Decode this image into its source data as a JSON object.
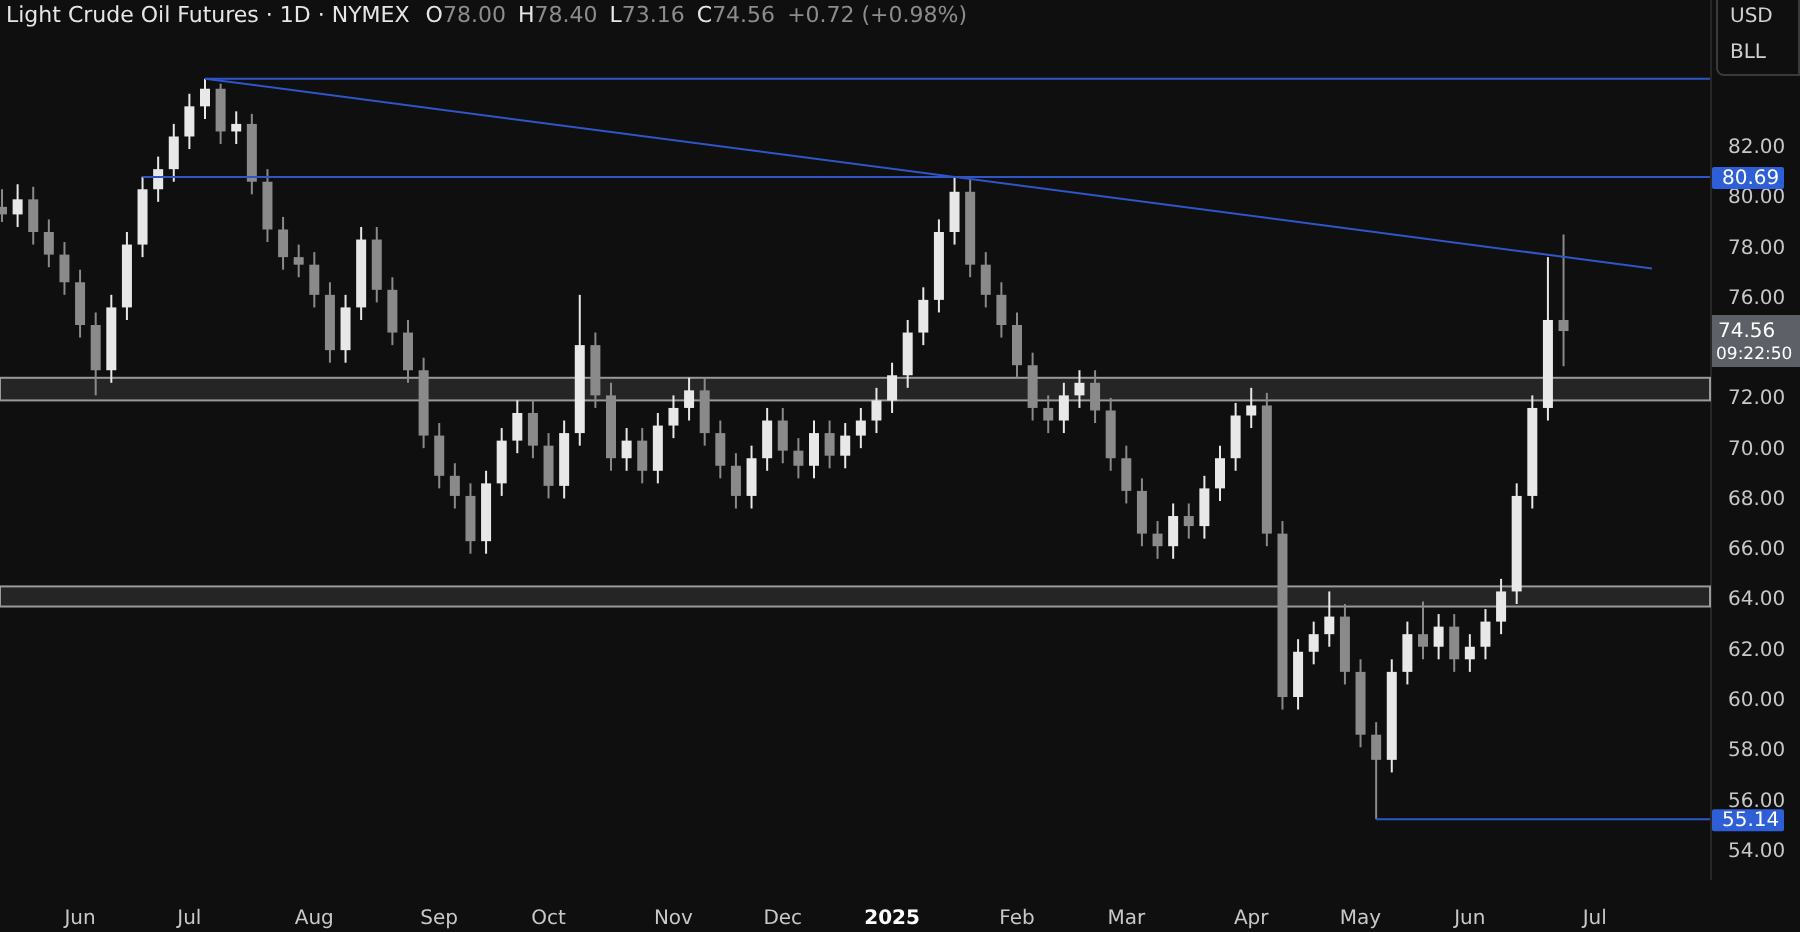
{
  "header": {
    "title": "Light Crude Oil Futures · 1D · NYMEX",
    "ohlc": [
      {
        "key": "O",
        "value": "78.00"
      },
      {
        "key": "H",
        "value": "78.40"
      },
      {
        "key": "L",
        "value": "73.16"
      },
      {
        "key": "C",
        "value": "74.56"
      }
    ],
    "change": "+0.72 (+0.98%)"
  },
  "currency_box": {
    "currency": "USD",
    "unit": "BLL"
  },
  "chart": {
    "chart_data": {
      "type": "candlestick",
      "categories": [
        null,
        null,
        null,
        null,
        null,
        "Jun",
        null,
        null,
        null,
        null,
        null,
        null,
        "Jul",
        null,
        null,
        null,
        null,
        null,
        null,
        null,
        "Aug",
        null,
        null,
        null,
        null,
        null,
        null,
        null,
        "Sep",
        null,
        null,
        null,
        null,
        null,
        null,
        "Oct",
        null,
        null,
        null,
        null,
        null,
        null,
        null,
        "Nov",
        null,
        null,
        null,
        null,
        null,
        null,
        "Dec",
        null,
        null,
        null,
        null,
        null,
        null,
        "2025",
        null,
        null,
        null,
        null,
        null,
        null,
        null,
        "Feb",
        null,
        null,
        null,
        null,
        null,
        null,
        "Mar",
        null,
        null,
        null,
        null,
        null,
        null,
        null,
        "Apr",
        null,
        null,
        null,
        null,
        null,
        null,
        "May",
        null,
        null,
        null,
        null,
        null,
        null,
        "Jun",
        null,
        null,
        null,
        null,
        null,
        null,
        null,
        "Jul",
        null,
        null
      ],
      "ylim": [
        52.72,
        87.73
      ],
      "ohlc": [
        [
          79.5,
          80.2,
          78.9,
          79.2
        ],
        [
          79.2,
          80.4,
          78.7,
          79.8
        ],
        [
          79.8,
          80.3,
          78.0,
          78.5
        ],
        [
          78.5,
          79.0,
          77.1,
          77.6
        ],
        [
          77.6,
          78.1,
          76.0,
          76.5
        ],
        [
          76.5,
          77.0,
          74.3,
          74.8
        ],
        [
          74.8,
          75.3,
          72.0,
          73.0
        ],
        [
          73.0,
          76.0,
          72.5,
          75.5
        ],
        [
          75.5,
          78.5,
          75.0,
          78.0
        ],
        [
          78.0,
          80.7,
          77.5,
          80.2
        ],
        [
          80.2,
          81.5,
          79.7,
          81.0
        ],
        [
          81.0,
          82.8,
          80.5,
          82.3
        ],
        [
          82.3,
          84.0,
          81.8,
          83.5
        ],
        [
          83.5,
          84.6,
          83.0,
          84.2
        ],
        [
          84.2,
          84.4,
          82.0,
          82.5
        ],
        [
          82.5,
          83.3,
          82.0,
          82.8
        ],
        [
          82.8,
          83.2,
          80.0,
          80.5
        ],
        [
          80.5,
          81.0,
          78.1,
          78.6
        ],
        [
          78.6,
          79.1,
          77.0,
          77.5
        ],
        [
          77.5,
          78.0,
          76.7,
          77.2
        ],
        [
          77.2,
          77.7,
          75.5,
          76.0
        ],
        [
          76.0,
          76.5,
          73.3,
          73.8
        ],
        [
          73.8,
          76.0,
          73.3,
          75.5
        ],
        [
          75.5,
          78.7,
          75.0,
          78.2
        ],
        [
          78.2,
          78.7,
          75.7,
          76.2
        ],
        [
          76.2,
          76.7,
          74.0,
          74.5
        ],
        [
          74.5,
          75.0,
          72.5,
          73.0
        ],
        [
          73.0,
          73.5,
          69.9,
          70.4
        ],
        [
          70.4,
          70.9,
          68.3,
          68.8
        ],
        [
          68.8,
          69.3,
          67.5,
          68.0
        ],
        [
          68.0,
          68.5,
          65.7,
          66.2
        ],
        [
          66.2,
          69.0,
          65.7,
          68.5
        ],
        [
          68.5,
          70.7,
          68.0,
          70.2
        ],
        [
          70.2,
          71.8,
          69.7,
          71.3
        ],
        [
          71.3,
          71.8,
          69.5,
          70.0
        ],
        [
          70.0,
          70.5,
          67.9,
          68.4
        ],
        [
          68.4,
          71.0,
          67.9,
          70.5
        ],
        [
          70.5,
          76.0,
          70.0,
          74.0
        ],
        [
          74.0,
          74.5,
          71.5,
          72.0
        ],
        [
          72.0,
          72.5,
          69.0,
          69.5
        ],
        [
          69.5,
          70.7,
          69.0,
          70.2
        ],
        [
          70.2,
          70.7,
          68.5,
          69.0
        ],
        [
          69.0,
          71.3,
          68.5,
          70.8
        ],
        [
          70.8,
          72.0,
          70.3,
          71.5
        ],
        [
          71.5,
          72.7,
          71.0,
          72.2
        ],
        [
          72.2,
          72.7,
          70.0,
          70.5
        ],
        [
          70.5,
          71.0,
          68.7,
          69.2
        ],
        [
          69.2,
          69.7,
          67.5,
          68.0
        ],
        [
          68.0,
          70.0,
          67.5,
          69.5
        ],
        [
          69.5,
          71.5,
          69.0,
          71.0
        ],
        [
          71.0,
          71.5,
          69.3,
          69.8
        ],
        [
          69.8,
          70.3,
          68.7,
          69.2
        ],
        [
          69.2,
          71.0,
          68.7,
          70.5
        ],
        [
          70.5,
          71.0,
          69.1,
          69.6
        ],
        [
          69.6,
          70.9,
          69.1,
          70.4
        ],
        [
          70.4,
          71.5,
          69.9,
          71.0
        ],
        [
          71.0,
          72.3,
          70.5,
          71.8
        ],
        [
          71.8,
          73.3,
          71.3,
          72.8
        ],
        [
          72.8,
          75.0,
          72.3,
          74.5
        ],
        [
          74.5,
          76.3,
          74.0,
          75.8
        ],
        [
          75.8,
          79.0,
          75.3,
          78.5
        ],
        [
          78.5,
          80.69,
          78.0,
          80.1
        ],
        [
          80.1,
          80.6,
          76.7,
          77.2
        ],
        [
          77.2,
          77.7,
          75.5,
          76.0
        ],
        [
          76.0,
          76.5,
          74.3,
          74.8
        ],
        [
          74.8,
          75.3,
          72.7,
          73.2
        ],
        [
          73.2,
          73.7,
          71.0,
          71.5
        ],
        [
          71.5,
          72.0,
          70.5,
          71.0
        ],
        [
          71.0,
          72.5,
          70.5,
          72.0
        ],
        [
          72.0,
          73.0,
          71.5,
          72.5
        ],
        [
          72.5,
          73.0,
          70.9,
          71.4
        ],
        [
          71.4,
          71.9,
          69.0,
          69.5
        ],
        [
          69.5,
          70.0,
          67.7,
          68.2
        ],
        [
          68.2,
          68.7,
          66.0,
          66.5
        ],
        [
          66.5,
          67.0,
          65.5,
          66.0
        ],
        [
          66.0,
          67.7,
          65.5,
          67.2
        ],
        [
          67.2,
          67.7,
          66.3,
          66.8
        ],
        [
          66.8,
          68.8,
          66.3,
          68.3
        ],
        [
          68.3,
          70.0,
          67.8,
          69.5
        ],
        [
          69.5,
          71.7,
          69.0,
          71.2
        ],
        [
          71.2,
          72.3,
          70.7,
          71.6
        ],
        [
          71.6,
          72.1,
          66.0,
          66.5
        ],
        [
          66.5,
          67.0,
          59.5,
          60.0
        ],
        [
          60.0,
          62.3,
          59.5,
          61.8
        ],
        [
          61.8,
          63.0,
          61.3,
          62.5
        ],
        [
          62.5,
          64.2,
          62.0,
          63.2
        ],
        [
          63.2,
          63.7,
          60.5,
          61.0
        ],
        [
          61.0,
          61.5,
          58.0,
          58.5
        ],
        [
          58.5,
          59.0,
          55.14,
          57.5
        ],
        [
          57.5,
          61.5,
          57.0,
          61.0
        ],
        [
          61.0,
          63.0,
          60.5,
          62.5
        ],
        [
          62.5,
          63.8,
          61.5,
          62.0
        ],
        [
          62.0,
          63.3,
          61.5,
          62.8
        ],
        [
          62.8,
          63.3,
          61.0,
          61.5
        ],
        [
          61.5,
          62.5,
          61.0,
          62.0
        ],
        [
          62.0,
          63.5,
          61.5,
          63.0
        ],
        [
          63.0,
          64.7,
          62.5,
          64.2
        ],
        [
          64.2,
          68.5,
          63.7,
          68.0
        ],
        [
          68.0,
          72.0,
          67.5,
          71.5
        ],
        [
          71.5,
          77.5,
          71.0,
          75.0
        ],
        [
          75.0,
          78.4,
          73.16,
          74.56
        ],
        null,
        null,
        null,
        null
      ],
      "yticks": [
        {
          "value": 54,
          "label": "54.00"
        },
        {
          "value": 56,
          "label": "56.00"
        },
        {
          "value": 58,
          "label": "58.00"
        },
        {
          "value": 60,
          "label": "60.00"
        },
        {
          "value": 62,
          "label": "62.00"
        },
        {
          "value": 64,
          "label": "64.00"
        },
        {
          "value": 66,
          "label": "66.00"
        },
        {
          "value": 68,
          "label": "68.00"
        },
        {
          "value": 70,
          "label": "70.00"
        },
        {
          "value": 72,
          "label": "72.00"
        },
        {
          "value": 76,
          "label": "76.00"
        },
        {
          "value": 78,
          "label": "78.00"
        },
        {
          "value": 80,
          "label": "80.00"
        },
        {
          "value": 82,
          "label": "82.00"
        }
      ],
      "ref_lines": [
        {
          "axis": "y",
          "value": 84.6
        },
        {
          "axis": "y",
          "value": 80.69,
          "label": "80.69"
        },
        {
          "axis": "y",
          "value": 55.14,
          "label": "55.14"
        }
      ],
      "bands": [
        {
          "axis": "y",
          "from": 71.8,
          "to": 72.7
        },
        {
          "axis": "y",
          "from": 63.6,
          "to": 64.4
        }
      ]
    },
    "last_price": {
      "label": "74.56",
      "countdown": "09:22:50"
    }
  }
}
